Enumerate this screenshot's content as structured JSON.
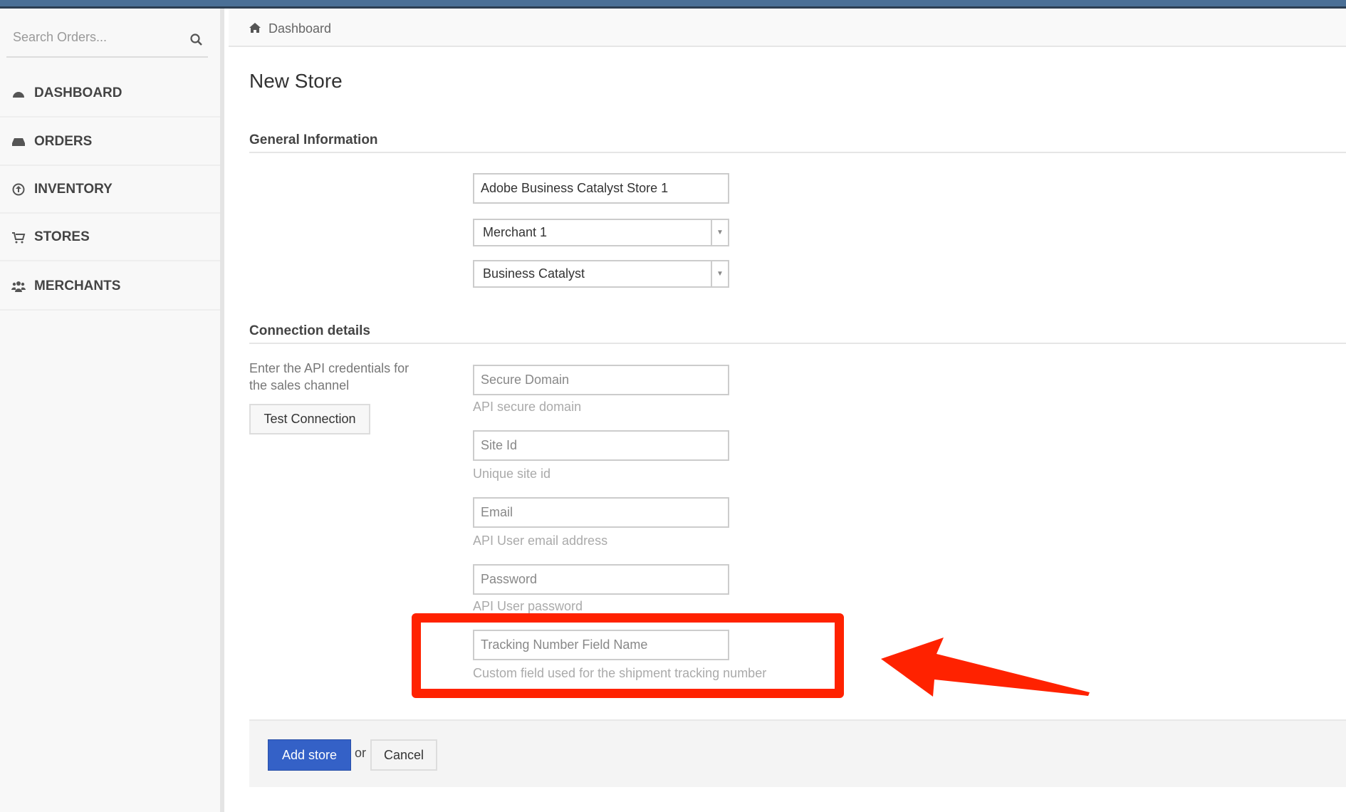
{
  "sidebar": {
    "search_placeholder": "Search Orders...",
    "items": [
      {
        "label": "DASHBOARD",
        "icon": "dashboard-icon"
      },
      {
        "label": "ORDERS",
        "icon": "inbox-icon"
      },
      {
        "label": "INVENTORY",
        "icon": "arrow-circle-up-icon"
      },
      {
        "label": "STORES",
        "icon": "cart-icon"
      },
      {
        "label": "MERCHANTS",
        "icon": "users-icon"
      }
    ]
  },
  "breadcrumb": {
    "label": "Dashboard",
    "icon": "home-icon"
  },
  "page": {
    "title": "New Store",
    "general": {
      "heading": "General Information",
      "store_name": "Adobe Business Catalyst Store 1",
      "merchant": "Merchant 1",
      "platform": "Business Catalyst"
    },
    "connection": {
      "heading": "Connection details",
      "help": "Enter the API credentials for the sales channel",
      "test_button": "Test Connection",
      "fields": [
        {
          "placeholder": "Secure Domain",
          "help": "API secure domain"
        },
        {
          "placeholder": "Site Id",
          "help": "Unique site id"
        },
        {
          "placeholder": "Email",
          "help": "API User email address"
        },
        {
          "placeholder": "Password",
          "help": "API User password"
        },
        {
          "placeholder": "Tracking Number Field Name",
          "help": "Custom field used for the shipment tracking number"
        }
      ]
    },
    "footer": {
      "submit": "Add store",
      "or": "or",
      "cancel": "Cancel"
    }
  },
  "colors": {
    "accent": "#3461c7",
    "annotation": "#ff2200",
    "topbar": "#4a6f96"
  }
}
